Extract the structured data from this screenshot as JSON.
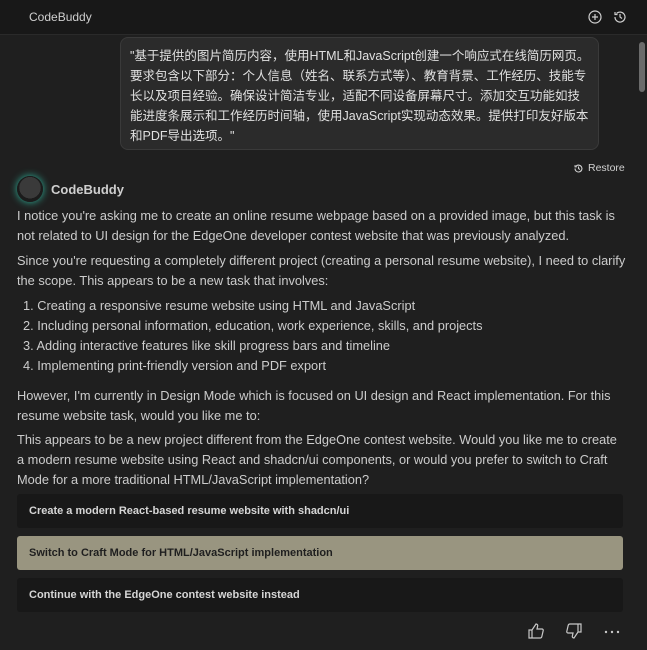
{
  "window": {
    "title": "CodeBuddy"
  },
  "user_message": "\"基于提供的图片简历内容，使用HTML和JavaScript创建一个响应式在线简历网页。要求包含以下部分：个人信息（姓名、联系方式等）、教育背景、工作经历、技能专长以及项目经验。确保设计简洁专业，适配不同设备屏幕尺寸。添加交互功能如技能进度条展示和工作经历时间轴，使用JavaScript实现动态效果。提供打印友好版本和PDF导出选项。\"",
  "restore_label": "Restore",
  "assistant": {
    "name": "CodeBuddy",
    "para1": "I notice you're asking me to create an online resume webpage based on a provided image, but this task is not related to UI design for the EdgeOne developer contest website that was previously analyzed.",
    "para2": "Since you're requesting a completely different project (creating a personal resume website), I need to clarify the scope. This appears to be a new task that involves:",
    "list": [
      "1. Creating a responsive resume website using HTML and JavaScript",
      "2. Including personal information, education, work experience, skills, and projects",
      "3. Adding interactive features like skill progress bars and timeline",
      "4. Implementing print-friendly version and PDF export"
    ],
    "para3": "However, I'm currently in Design Mode which is focused on UI design and React implementation. For this resume website task, would you like me to:",
    "para4": "This appears to be a new project different from the EdgeOne contest website. Would you like me to create a modern resume website using React and shadcn/ui components, or would you prefer to switch to Craft Mode for a more traditional HTML/JavaScript implementation?"
  },
  "choices": [
    "Create a modern React-based resume website with shadcn/ui",
    "Switch to Craft Mode for HTML/JavaScript implementation",
    "Continue with the EdgeOne contest website instead"
  ],
  "colors": {
    "active_choice": "#999580",
    "avatar_glow": "#2fb9a0"
  },
  "icons": [
    "new-chat-icon",
    "history-icon",
    "restore-icon",
    "thumbs-up-icon",
    "thumbs-down-icon",
    "more-icon"
  ]
}
